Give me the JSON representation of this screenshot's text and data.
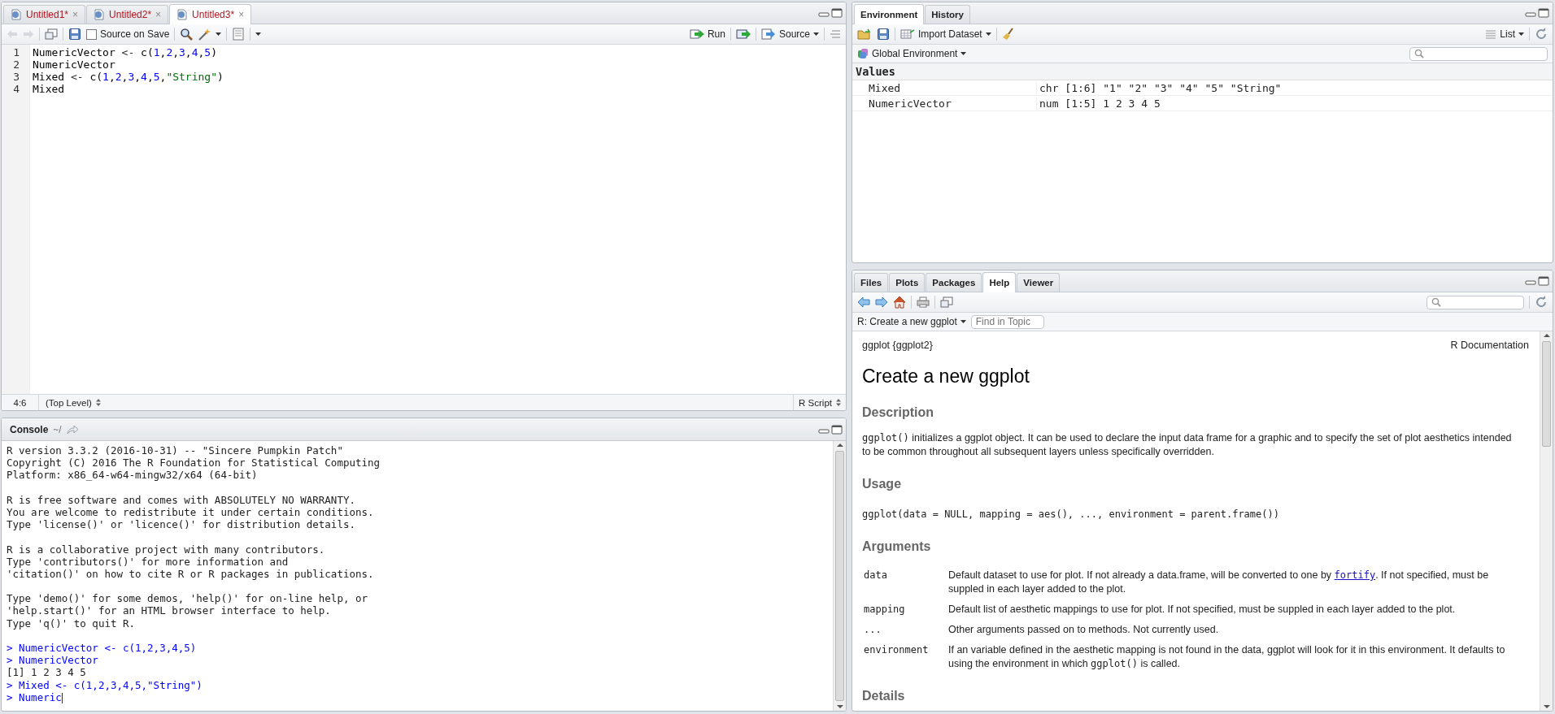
{
  "editor": {
    "tabs": [
      {
        "label": "Untitled1*",
        "close": "×",
        "selected": false
      },
      {
        "label": "Untitled2*",
        "close": "×",
        "selected": false
      },
      {
        "label": "Untitled3*",
        "close": "×",
        "selected": true
      }
    ],
    "source_on_save": {
      "label": "Source on Save",
      "checked": false
    },
    "run": "Run",
    "source": "Source",
    "lines": [
      {
        "number": "1",
        "tokens": [
          {
            "text": "NumericVector ",
            "kind": "ident"
          },
          {
            "text": "<-",
            "kind": "op"
          },
          {
            "text": " c(",
            "kind": "ident"
          },
          {
            "text": "1",
            "kind": "num"
          },
          {
            "text": ",",
            "kind": "ident"
          },
          {
            "text": "2",
            "kind": "num"
          },
          {
            "text": ",",
            "kind": "ident"
          },
          {
            "text": "3",
            "kind": "num"
          },
          {
            "text": ",",
            "kind": "ident"
          },
          {
            "text": "4",
            "kind": "num"
          },
          {
            "text": ",",
            "kind": "ident"
          },
          {
            "text": "5",
            "kind": "num"
          },
          {
            "text": ")",
            "kind": "ident"
          }
        ]
      },
      {
        "number": "2",
        "tokens": [
          {
            "text": "NumericVector",
            "kind": "ident"
          }
        ]
      },
      {
        "number": "3",
        "tokens": [
          {
            "text": "Mixed ",
            "kind": "ident"
          },
          {
            "text": "<-",
            "kind": "op"
          },
          {
            "text": " c(",
            "kind": "ident"
          },
          {
            "text": "1",
            "kind": "num"
          },
          {
            "text": ",",
            "kind": "ident"
          },
          {
            "text": "2",
            "kind": "num"
          },
          {
            "text": ",",
            "kind": "ident"
          },
          {
            "text": "3",
            "kind": "num"
          },
          {
            "text": ",",
            "kind": "ident"
          },
          {
            "text": "4",
            "kind": "num"
          },
          {
            "text": ",",
            "kind": "ident"
          },
          {
            "text": "5",
            "kind": "num"
          },
          {
            "text": ",",
            "kind": "ident"
          },
          {
            "text": "\"String\"",
            "kind": "str"
          },
          {
            "text": ")",
            "kind": "ident"
          }
        ]
      },
      {
        "number": "4",
        "tokens": [
          {
            "text": "Mixed",
            "kind": "ident"
          }
        ]
      }
    ],
    "status": {
      "position": "4:6",
      "scope": "(Top Level)",
      "file_type": "R Script"
    }
  },
  "console": {
    "title": "Console",
    "path": "~/",
    "lines": [
      {
        "kind": "output",
        "text": "R version 3.3.2 (2016-10-31) -- \"Sincere Pumpkin Patch\""
      },
      {
        "kind": "output",
        "text": "Copyright (C) 2016 The R Foundation for Statistical Computing"
      },
      {
        "kind": "output",
        "text": "Platform: x86_64-w64-mingw32/x64 (64-bit)"
      },
      {
        "kind": "blank"
      },
      {
        "kind": "output",
        "text": "R is free software and comes with ABSOLUTELY NO WARRANTY."
      },
      {
        "kind": "output",
        "text": "You are welcome to redistribute it under certain conditions."
      },
      {
        "kind": "output",
        "text": "Type 'license()' or 'licence()' for distribution details."
      },
      {
        "kind": "blank"
      },
      {
        "kind": "output",
        "text": "R is a collaborative project with many contributors."
      },
      {
        "kind": "output",
        "text": "Type 'contributors()' for more information and"
      },
      {
        "kind": "output",
        "text": "'citation()' on how to cite R or R packages in publications."
      },
      {
        "kind": "blank"
      },
      {
        "kind": "output",
        "text": "Type 'demo()' for some demos, 'help()' for on-line help, or"
      },
      {
        "kind": "output",
        "text": "'help.start()' for an HTML browser interface to help."
      },
      {
        "kind": "output",
        "text": "Type 'q()' to quit R."
      },
      {
        "kind": "blank"
      },
      {
        "kind": "input",
        "text": "> NumericVector <- c(1,2,3,4,5)"
      },
      {
        "kind": "input",
        "text": "> NumericVector"
      },
      {
        "kind": "output",
        "text": "[1] 1 2 3 4 5"
      },
      {
        "kind": "input",
        "text": "> Mixed <- c(1,2,3,4,5,\"String\")"
      },
      {
        "kind": "input",
        "text": "> Numeric",
        "cursor": true
      }
    ]
  },
  "environment": {
    "tabs": [
      {
        "label": "Environment",
        "selected": true
      },
      {
        "label": "History",
        "selected": false
      }
    ],
    "import": "Import Dataset",
    "view": "List",
    "scope": "Global Environment",
    "section": "Values",
    "rows": [
      {
        "name": "Mixed",
        "value": "chr [1:6] \"1\" \"2\" \"3\" \"4\" \"5\" \"String\""
      },
      {
        "name": "NumericVector",
        "value": "num [1:5] 1 2 3 4 5"
      }
    ]
  },
  "help_pane": {
    "tabs": [
      {
        "label": "Files",
        "selected": false
      },
      {
        "label": "Plots",
        "selected": false
      },
      {
        "label": "Packages",
        "selected": false
      },
      {
        "label": "Help",
        "selected": true
      },
      {
        "label": "Viewer",
        "selected": false
      }
    ],
    "topic": "R: Create a new ggplot",
    "find_placeholder": "Find in Topic",
    "header_left": "ggplot {ggplot2}",
    "header_right": "R Documentation",
    "title": "Create a new ggplot",
    "sections": [
      {
        "kind": "paragraph",
        "heading": "Description",
        "parts": [
          {
            "kind": "code",
            "text": "ggplot()"
          },
          {
            "kind": "text",
            "text": " initializes a ggplot object. It can be used to declare the input data frame for a graphic and to specify the set of plot aesthetics intended to be common throughout all subsequent layers unless specifically overridden."
          }
        ]
      },
      {
        "kind": "code",
        "heading": "Usage",
        "text": "ggplot(data = NULL, mapping = aes(), ..., environment = parent.frame())"
      },
      {
        "kind": "arguments",
        "heading": "Arguments",
        "items": [
          {
            "name": "data",
            "parts": [
              {
                "kind": "text",
                "text": "Default dataset to use for plot. If not already a data.frame, will be converted to one by "
              },
              {
                "kind": "link",
                "text": "fortify"
              },
              {
                "kind": "text",
                "text": ". If not specified, must be suppled in each layer added to the plot."
              }
            ]
          },
          {
            "name": "mapping",
            "parts": [
              {
                "kind": "text",
                "text": "Default list of aesthetic mappings to use for plot. If not specified, must be suppled in each layer added to the plot."
              }
            ]
          },
          {
            "name": "...",
            "parts": [
              {
                "kind": "text",
                "text": "Other arguments passed on to methods. Not currently used."
              }
            ]
          },
          {
            "name": "environment",
            "parts": [
              {
                "kind": "text",
                "text": "If an variable defined in the aesthetic mapping is not found in the data, ggplot will look for it in this environment. It defaults to using the environment in which "
              },
              {
                "kind": "code",
                "text": "ggplot()"
              },
              {
                "kind": "text",
                "text": " is called."
              }
            ]
          }
        ]
      },
      {
        "kind": "heading",
        "heading": "Details"
      }
    ]
  }
}
